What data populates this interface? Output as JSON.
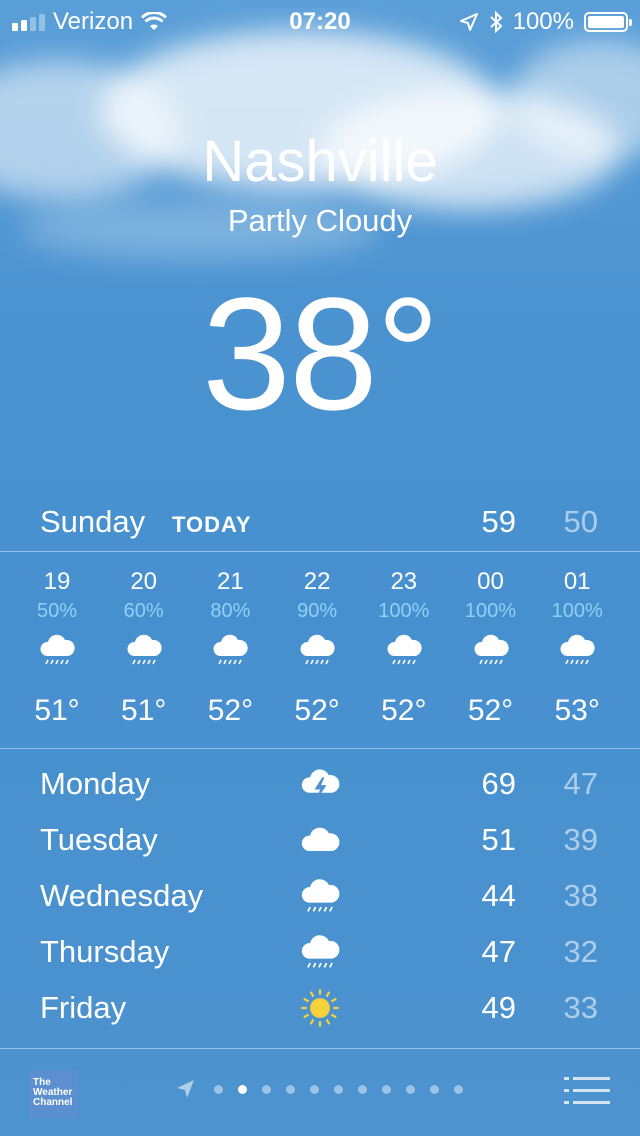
{
  "status_bar": {
    "carrier": "Verizon",
    "time": "07:20",
    "battery": "100%",
    "signal_bars": 2,
    "signal_total": 4,
    "icons": [
      "wifi-icon",
      "location-arrow-icon",
      "bluetooth-icon",
      "battery-icon"
    ]
  },
  "location": {
    "city": "Nashville",
    "condition": "Partly Cloudy",
    "temperature": "38°"
  },
  "today": {
    "day": "Sunday",
    "label": "TODAY",
    "high": "59",
    "low": "50"
  },
  "hourly": [
    {
      "time": "19",
      "precip": "50%",
      "icon": "rain-cloud-icon",
      "temp": "51°"
    },
    {
      "time": "20",
      "precip": "60%",
      "icon": "rain-cloud-icon",
      "temp": "51°"
    },
    {
      "time": "21",
      "precip": "80%",
      "icon": "rain-cloud-icon",
      "temp": "52°"
    },
    {
      "time": "22",
      "precip": "90%",
      "icon": "rain-cloud-icon",
      "temp": "52°"
    },
    {
      "time": "23",
      "precip": "100%",
      "icon": "rain-cloud-icon",
      "temp": "52°"
    },
    {
      "time": "00",
      "precip": "100%",
      "icon": "rain-cloud-icon",
      "temp": "52°"
    },
    {
      "time": "01",
      "precip": "100%",
      "icon": "rain-cloud-icon",
      "temp": "53°"
    }
  ],
  "daily": [
    {
      "day": "Monday",
      "icon": "thunderstorm-icon",
      "high": "69",
      "low": "47"
    },
    {
      "day": "Tuesday",
      "icon": "cloud-icon",
      "high": "51",
      "low": "39"
    },
    {
      "day": "Wednesday",
      "icon": "rain-cloud-icon",
      "high": "44",
      "low": "38"
    },
    {
      "day": "Thursday",
      "icon": "rain-cloud-icon",
      "high": "47",
      "low": "32"
    },
    {
      "day": "Friday",
      "icon": "sun-icon",
      "high": "49",
      "low": "33"
    }
  ],
  "bottom_bar": {
    "logo_lines": [
      "The",
      "Weather",
      "Channel"
    ],
    "page_count": 11,
    "active_page": 1
  },
  "colors": {
    "sky_top": "#5b9fd8",
    "sky_bottom": "#4c93cf",
    "precip_text": "#8fd0f7",
    "sun": "#f7d23b",
    "low_temp": "rgba(255,255,255,0.55)"
  }
}
